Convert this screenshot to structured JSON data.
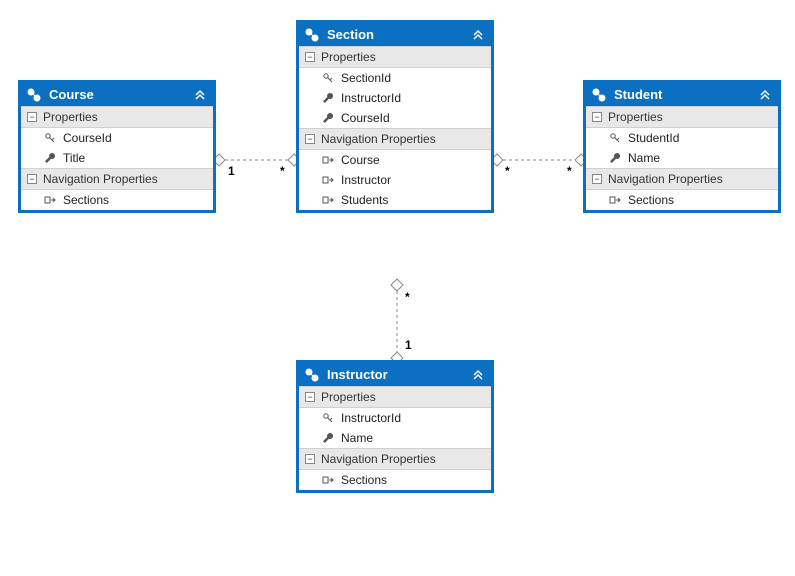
{
  "colors": {
    "accent": "#0b6fc2",
    "groupBg": "#e8e8e8"
  },
  "groups": {
    "properties_label": "Properties",
    "navprops_label": "Navigation Properties"
  },
  "icons": {
    "entity_header": "class-icon",
    "collapse": "chevron-double-up-icon",
    "toggle_minus": "minus-icon",
    "key": "key-icon",
    "wrench": "wrench-icon",
    "nav": "navigation-property-icon"
  },
  "entities": {
    "course": {
      "name": "Course",
      "properties": [
        {
          "icon": "key",
          "label": "CourseId"
        },
        {
          "icon": "wrench",
          "label": "Title"
        }
      ],
      "navprops": [
        {
          "icon": "nav",
          "label": "Sections"
        }
      ]
    },
    "section": {
      "name": "Section",
      "properties": [
        {
          "icon": "key",
          "label": "SectionId"
        },
        {
          "icon": "wrench",
          "label": "InstructorId"
        },
        {
          "icon": "wrench",
          "label": "CourseId"
        }
      ],
      "navprops": [
        {
          "icon": "nav",
          "label": "Course"
        },
        {
          "icon": "nav",
          "label": "Instructor"
        },
        {
          "icon": "nav",
          "label": "Students"
        }
      ]
    },
    "student": {
      "name": "Student",
      "properties": [
        {
          "icon": "key",
          "label": "StudentId"
        },
        {
          "icon": "wrench",
          "label": "Name"
        }
      ],
      "navprops": [
        {
          "icon": "nav",
          "label": "Sections"
        }
      ]
    },
    "instructor": {
      "name": "Instructor",
      "properties": [
        {
          "icon": "key",
          "label": "InstructorId"
        },
        {
          "icon": "wrench",
          "label": "Name"
        }
      ],
      "navprops": [
        {
          "icon": "nav",
          "label": "Sections"
        }
      ]
    }
  },
  "relationships": [
    {
      "from": "course",
      "to": "section",
      "from_card": "1",
      "to_card": "*"
    },
    {
      "from": "section",
      "to": "student",
      "from_card": "*",
      "to_card": "*"
    },
    {
      "from": "section",
      "to": "instructor",
      "from_card": "*",
      "to_card": "1"
    }
  ],
  "cardinality_labels": {
    "cs_left": "1",
    "cs_right": "*",
    "ss_left": "*",
    "ss_right": "*",
    "si_top": "*",
    "si_bottom": "1"
  }
}
